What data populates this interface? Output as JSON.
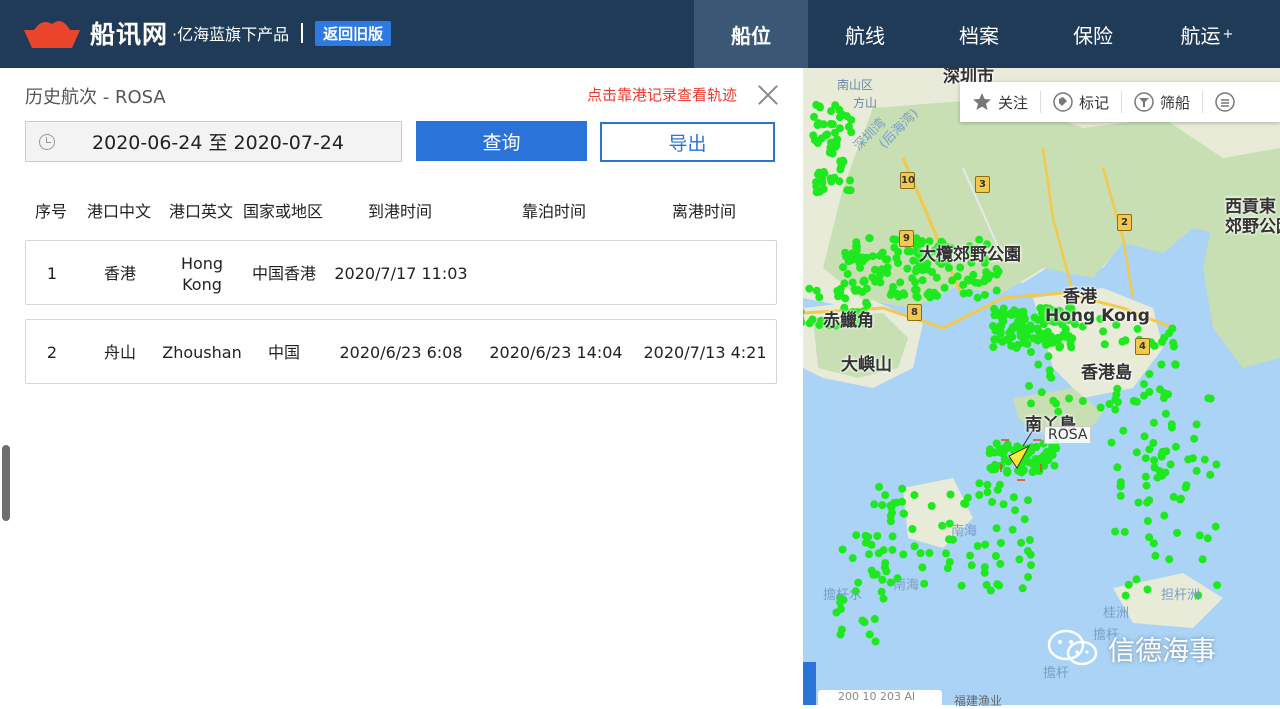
{
  "header": {
    "logo_name": "船讯网",
    "logo_sub": "·亿海蓝旗下产品",
    "old_version_label": "返回旧版",
    "nav": [
      "船位",
      "航线",
      "档案",
      "保险",
      "航运"
    ],
    "nav_plus": "+"
  },
  "panel": {
    "title": "历史航次 - ROSA",
    "hint": "点击靠港记录查看轨迹",
    "date_range": "2020-06-24 至 2020-07-24",
    "query_label": "查询",
    "export_label": "导出",
    "columns": [
      "序号",
      "港口中文",
      "港口英文",
      "国家或地区",
      "到港时间",
      "靠泊时间",
      "离港时间"
    ],
    "rows": [
      {
        "no": "1",
        "cn": "香港",
        "en_line1": "Hong",
        "en_line2": "Kong",
        "country": "中国香港",
        "arrive": "2020/7/17 11:03",
        "berth": "",
        "depart": ""
      },
      {
        "no": "2",
        "cn": "舟山",
        "en_line1": "Zhoushan",
        "en_line2": "",
        "country": "中国",
        "arrive": "2020/6/23 6:08",
        "berth": "2020/6/23 14:04",
        "depart": "2020/7/13 4:21"
      }
    ]
  },
  "map": {
    "toolbar": [
      "关注",
      "标记",
      "筛船"
    ],
    "places": {
      "shenzhen": "深圳市",
      "taimo": "大欖郊野公園",
      "hongkong": "香港",
      "hongkong_en": "Hong Kong",
      "chek": "赤鱲角",
      "lantau": "大嶼山",
      "hkisland": "香港島",
      "lamma": "南丫島",
      "saikung": "西貢東",
      "saikung2": "郊野公園",
      "shekou": "南山区",
      "shenzhenbay": "深圳湾",
      "shenzhenbay2": "(后海湾)",
      "fangshan": "方山",
      "tamshui": "擔杆水",
      "nanhai": "南海",
      "nanhai2": "南海",
      "dangan": "擔杆",
      "dangan2": "擔杆",
      "jiwuzhou": "桂洲",
      "chinesebay": "担杆洲"
    },
    "roads": [
      "10",
      "3",
      "9",
      "2",
      "8",
      "4"
    ],
    "ship_label": "ROSA",
    "watermark": "信德海事",
    "scale_text": "200 10 203 Al",
    "note": "福建渔业"
  },
  "colors": {
    "header_bg": "#1f3b57",
    "accent_blue": "#2a73d9",
    "hint_red": "#e83a2e",
    "ship_dot": "#1ee81e",
    "water": "#aad3f5",
    "land": "#e8ebd8",
    "park": "#c8dfb4"
  }
}
